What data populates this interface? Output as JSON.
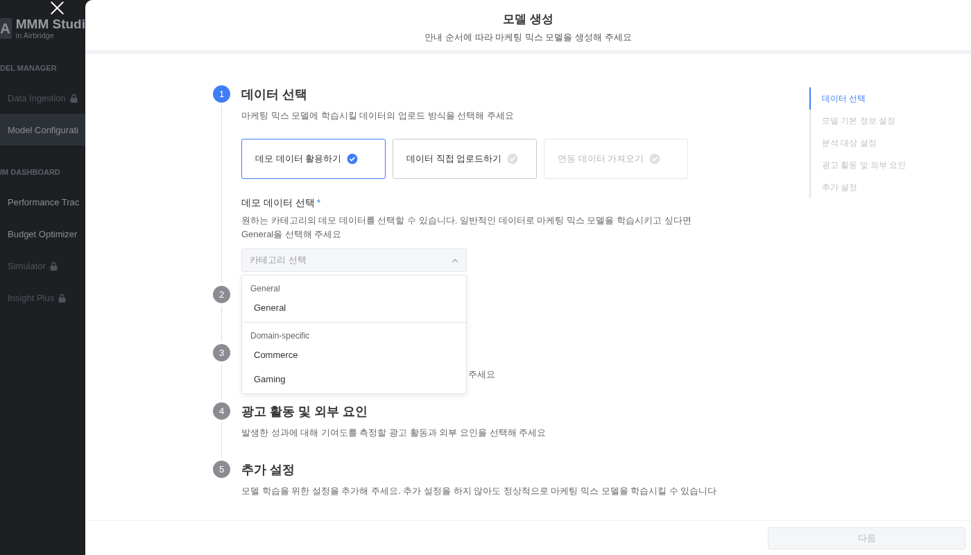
{
  "sidebar": {
    "logo": {
      "letter": "A",
      "title": "MMM Studi",
      "subtitle": "in Airbridge"
    },
    "sections": [
      {
        "label": "DEL MANAGER",
        "items": [
          {
            "label": "Data Ingestion",
            "locked": true,
            "selected": false
          },
          {
            "label": "Model Configurati",
            "locked": false,
            "selected": true
          }
        ]
      },
      {
        "label": "IM DASHBOARD",
        "items": [
          {
            "label": "Performance Trac",
            "locked": false,
            "selected": false
          },
          {
            "label": "Budget Optimizer",
            "locked": false,
            "selected": false
          },
          {
            "label": "Simulator",
            "locked": true,
            "selected": false
          },
          {
            "label": "Insight Plus",
            "locked": true,
            "selected": false
          }
        ]
      }
    ]
  },
  "modal": {
    "title": "모델 생성",
    "subtitle": "안내 순서에 따라 마케팅 믹스 모델을 생성해 주세요"
  },
  "steps": [
    {
      "number": "1",
      "title": "데이터 선택",
      "description": "마케팅 믹스 모델에 학습시킬 데이터의 업로드 방식을 선택해 주세요",
      "active": true
    },
    {
      "number": "2",
      "active": false
    },
    {
      "number": "3",
      "description": "주세요",
      "active": false,
      "covered": true
    },
    {
      "number": "4",
      "title": "광고 활동 및 외부 요인",
      "description": "발생한 성과에 대해 기여도를 측정할 광고 활동과 외부 요인을 선택해 주세요",
      "active": false
    },
    {
      "number": "5",
      "title": "추가 설정",
      "description": "모델 학습을 위한 설정을 추가해 주세요. 추가 설정을 하지 않아도 정상적으로 마케팅 믹스 모델을 학습시킬 수 있습니다",
      "active": false
    }
  ],
  "options": [
    {
      "label": "데모 데이터 활용하기",
      "selected": true,
      "disabled": false
    },
    {
      "label": "데이터 직접 업로드하기",
      "selected": false,
      "disabled": false
    },
    {
      "label": "연동 데이터 가져오기",
      "selected": false,
      "disabled": true
    }
  ],
  "field": {
    "label": "데모 데이터 선택",
    "required_mark": "*",
    "help": "원하는 카테고리의 데모 데이터를 선택할 수 있습니다. 일반적인 데이터로 마케팅 믹스 모델을 학습시키고 싶다면 General을 선택해 주세요",
    "placeholder": "카테고리 선택",
    "expanded": true
  },
  "dropdown": [
    {
      "label": "General",
      "options": [
        "General"
      ]
    },
    {
      "label": "Domain-specific",
      "options": [
        "Commerce",
        "Gaming"
      ]
    }
  ],
  "nav": [
    {
      "label": "데이터 선택",
      "selected": true
    },
    {
      "label": "모델 기본 정보 설정",
      "selected": false
    },
    {
      "label": "분석 대상 설정",
      "selected": false
    },
    {
      "label": "광고 활동 및 외부 요인",
      "selected": false
    },
    {
      "label": "추가 설정",
      "selected": false
    }
  ],
  "footer": {
    "button": {
      "label": "다음",
      "disabled": true
    }
  }
}
